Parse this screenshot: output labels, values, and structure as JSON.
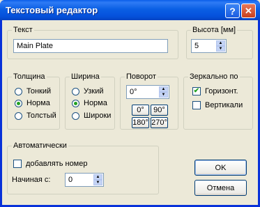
{
  "window": {
    "title": "Текстовый редактор"
  },
  "titlebar": {
    "help_symbol": "?",
    "close_symbol": "✕"
  },
  "text_group": {
    "legend": "Текст",
    "value": "Main Plate"
  },
  "height_group": {
    "legend": "Высота [мм]",
    "value": "5"
  },
  "thickness_group": {
    "legend": "Толщина",
    "options": [
      {
        "label": "Тонкий",
        "selected": false
      },
      {
        "label": "Норма",
        "selected": true
      },
      {
        "label": "Толстый",
        "selected": false
      }
    ]
  },
  "width_group": {
    "legend": "Ширина",
    "options": [
      {
        "label": "Узкий",
        "selected": false
      },
      {
        "label": "Норма",
        "selected": true
      },
      {
        "label": "Широки",
        "selected": false
      }
    ]
  },
  "rotation_group": {
    "legend": "Поворот",
    "value": "0°",
    "buttons": [
      "0°",
      "90°",
      "180°",
      "270°"
    ]
  },
  "mirror_group": {
    "legend": "Зеркально по",
    "options": [
      {
        "label": "Горизонт.",
        "checked": true
      },
      {
        "label": "Вертикали",
        "checked": false
      }
    ]
  },
  "auto_group": {
    "legend": "Автоматически",
    "add_number_label": "добавлять номер",
    "add_number_checked": false,
    "start_label": "Начиная с:",
    "start_value": "0"
  },
  "buttons": {
    "ok_label": "OK",
    "cancel_label": "Отмена"
  },
  "glyphs": {
    "spin_up": "▲",
    "spin_down": "▼",
    "check_mark": "✔"
  },
  "colors": {
    "title_bar": "#0a5fe4",
    "dialog_bg": "#ece9d8",
    "close_button": "#d0502c",
    "check_green": "#21a121"
  }
}
